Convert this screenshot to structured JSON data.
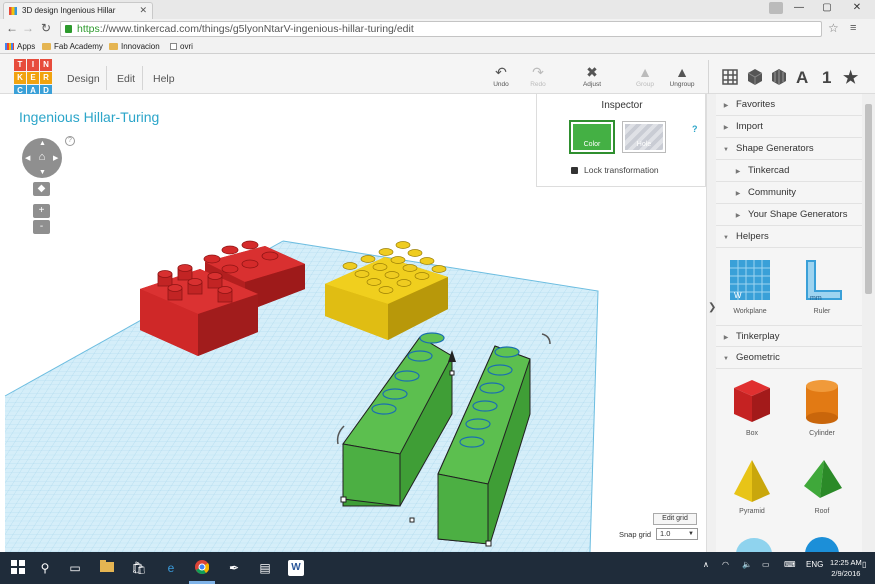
{
  "browser": {
    "tab_title": "3D design Ingenious Hillar",
    "url_scheme": "https",
    "url_rest": "://www.tinkercad.com/things/g5lyonNtarV-ingenious-hillar-turing/edit",
    "bookmarks": [
      "Apps",
      "Fab Academy",
      "Innovacion",
      "ovri"
    ]
  },
  "header": {
    "logo_letters": [
      "T",
      "I",
      "N",
      "K",
      "E",
      "R",
      "C",
      "A",
      "D"
    ],
    "menu": [
      "Design",
      "Edit",
      "Help"
    ],
    "tools": [
      {
        "label": "Undo",
        "icon": "undo-icon",
        "enabled": true
      },
      {
        "label": "Redo",
        "icon": "redo-icon",
        "enabled": false
      },
      {
        "label": "Adjust",
        "icon": "adjust-icon",
        "enabled": true
      },
      {
        "label": "Group",
        "icon": "group-icon",
        "enabled": false
      },
      {
        "label": "Ungroup",
        "icon": "ungroup-icon",
        "enabled": true
      }
    ],
    "right_icons": [
      "workplane-grid-icon",
      "box-view-icon",
      "ball-view-icon",
      "text-icon",
      "number-icon",
      "star-icon"
    ],
    "text_icon_label": "A",
    "number_icon_label": "1"
  },
  "design": {
    "title": "Ingenious Hillar-Turing"
  },
  "inspector": {
    "title": "Inspector",
    "color_label": "Color",
    "hole_label": "Hole",
    "lock_label": "Lock transformation",
    "help": "?"
  },
  "grid": {
    "edit_label": "Edit grid",
    "snap_label": "Snap grid",
    "snap_value": "1.0"
  },
  "sidebar": {
    "sections": [
      {
        "label": "Favorites",
        "expanded": false,
        "level": 0
      },
      {
        "label": "Import",
        "expanded": false,
        "level": 0
      },
      {
        "label": "Shape Generators",
        "expanded": true,
        "level": 0
      },
      {
        "label": "Tinkercad",
        "expanded": false,
        "level": 1
      },
      {
        "label": "Community",
        "expanded": false,
        "level": 1
      },
      {
        "label": "Your Shape Generators",
        "expanded": false,
        "level": 1
      },
      {
        "label": "Helpers",
        "expanded": true,
        "level": 0
      }
    ],
    "helpers": [
      "Workplane",
      "Ruler"
    ],
    "tinkerplay": "Tinkerplay",
    "geometric": "Geometric",
    "shapes": [
      "Box",
      "Cylinder",
      "Pyramid",
      "Roof"
    ]
  },
  "taskbar": {
    "time": "12:25 AM",
    "date": "2/9/2016",
    "lang": "ENG"
  },
  "colors": {
    "accent": "#2ba5c9",
    "brick_red": "#d42a2a",
    "brick_yellow": "#e8c417",
    "brick_green": "#4caf43",
    "grid": "#a8d8ee"
  }
}
